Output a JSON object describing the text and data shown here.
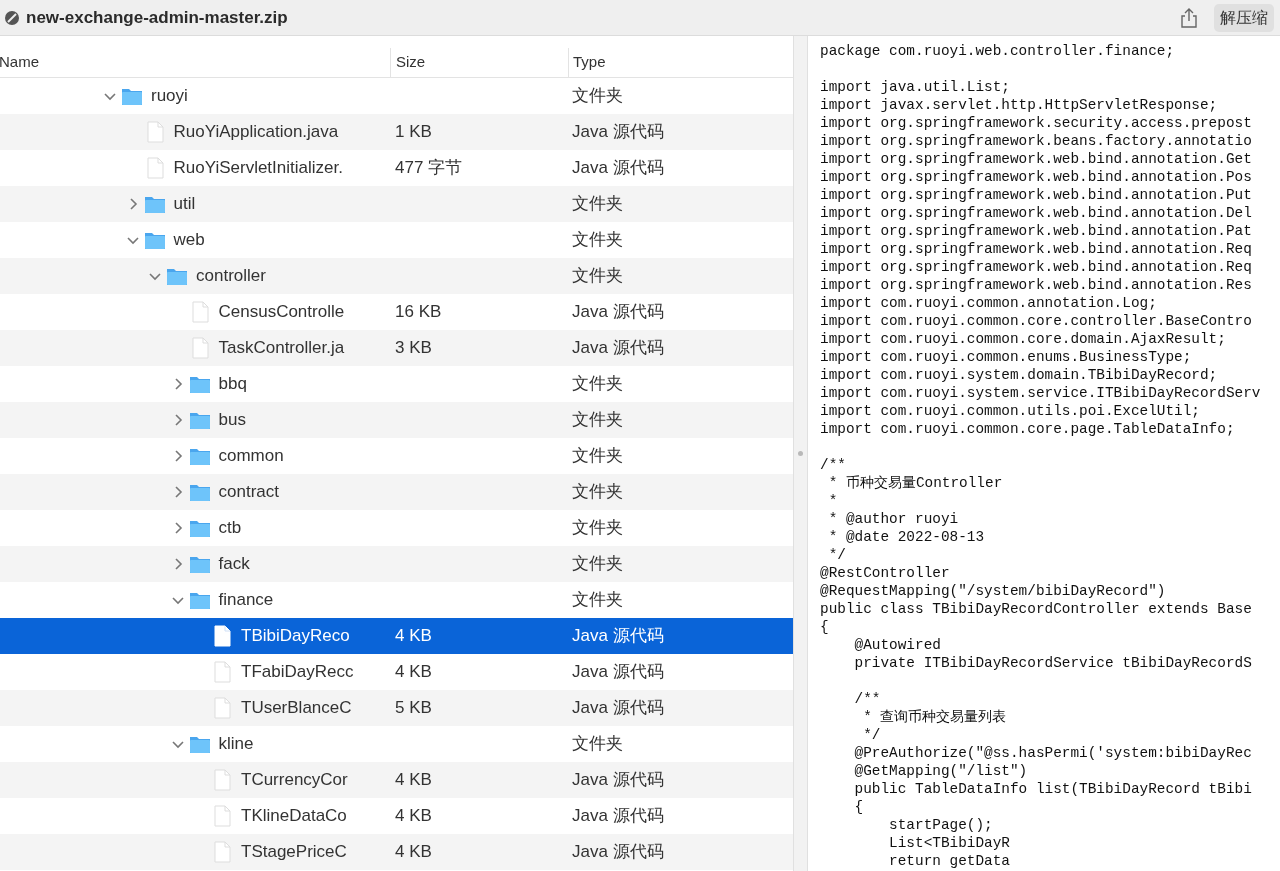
{
  "window": {
    "title": "new-exchange-admin-master.zip",
    "extract_button": "解压缩"
  },
  "columns": [
    "Name",
    "Size",
    "Type"
  ],
  "tree": [
    {
      "name": "ruoyi",
      "kind": "folder",
      "expanded": true,
      "selected": false,
      "type": "文件夹",
      "children": [
        {
          "name": "RuoYiApplication.java",
          "kind": "file",
          "selected": false,
          "size": "1 KB",
          "type": "Java 源代码"
        },
        {
          "name": "RuoYiServletInitializer.",
          "kind": "file",
          "selected": false,
          "size": "477 字节",
          "type": "Java 源代码"
        },
        {
          "name": "util",
          "kind": "folder",
          "expanded": false,
          "selected": false,
          "type": "文件夹"
        },
        {
          "name": "web",
          "kind": "folder",
          "expanded": true,
          "selected": false,
          "type": "文件夹",
          "children": [
            {
              "name": "controller",
              "kind": "folder",
              "expanded": true,
              "selected": false,
              "type": "文件夹",
              "children": [
                {
                  "name": "CensusControlle",
                  "kind": "file",
                  "selected": false,
                  "size": "16 KB",
                  "type": "Java 源代码"
                },
                {
                  "name": "TaskController.ja",
                  "kind": "file",
                  "selected": false,
                  "size": "3 KB",
                  "type": "Java 源代码"
                },
                {
                  "name": "bbq",
                  "kind": "folder",
                  "expanded": false,
                  "selected": false,
                  "type": "文件夹"
                },
                {
                  "name": "bus",
                  "kind": "folder",
                  "expanded": false,
                  "selected": false,
                  "type": "文件夹"
                },
                {
                  "name": "common",
                  "kind": "folder",
                  "expanded": false,
                  "selected": false,
                  "type": "文件夹"
                },
                {
                  "name": "contract",
                  "kind": "folder",
                  "expanded": false,
                  "selected": false,
                  "type": "文件夹"
                },
                {
                  "name": "ctb",
                  "kind": "folder",
                  "expanded": false,
                  "selected": false,
                  "type": "文件夹"
                },
                {
                  "name": "fack",
                  "kind": "folder",
                  "expanded": false,
                  "selected": false,
                  "type": "文件夹"
                },
                {
                  "name": "finance",
                  "kind": "folder",
                  "expanded": true,
                  "selected": false,
                  "type": "文件夹",
                  "children": [
                    {
                      "name": "TBibiDayReco",
                      "kind": "file",
                      "selected": true,
                      "size": "4 KB",
                      "type": "Java 源代码"
                    },
                    {
                      "name": "TFabiDayRecc",
                      "kind": "file",
                      "selected": false,
                      "size": "4 KB",
                      "type": "Java 源代码"
                    },
                    {
                      "name": "TUserBlanceC",
                      "kind": "file",
                      "selected": false,
                      "size": "5 KB",
                      "type": "Java 源代码"
                    }
                  ]
                },
                {
                  "name": "kline",
                  "kind": "folder",
                  "expanded": true,
                  "selected": false,
                  "type": "文件夹",
                  "children": [
                    {
                      "name": "TCurrencyCor",
                      "kind": "file",
                      "selected": false,
                      "size": "4 KB",
                      "type": "Java 源代码"
                    },
                    {
                      "name": "TKlineDataCo",
                      "kind": "file",
                      "selected": false,
                      "size": "4 KB",
                      "type": "Java 源代码"
                    },
                    {
                      "name": "TStagePriceC",
                      "kind": "file",
                      "selected": false,
                      "size": "4 KB",
                      "type": "Java 源代码"
                    }
                  ]
                }
              ]
            }
          ]
        }
      ]
    }
  ],
  "preview": {
    "code_blocks": [
      [
        "package com.ruoyi.web.controller.finance;"
      ],
      [
        "import java.util.List;",
        "import javax.servlet.http.HttpServletResponse;",
        "import org.springframework.security.access.prepost",
        "import org.springframework.beans.factory.annotatio",
        "import org.springframework.web.bind.annotation.Get",
        "import org.springframework.web.bind.annotation.Pos",
        "import org.springframework.web.bind.annotation.Put",
        "import org.springframework.web.bind.annotation.Del",
        "import org.springframework.web.bind.annotation.Pat",
        "import org.springframework.web.bind.annotation.Req",
        "import org.springframework.web.bind.annotation.Req",
        "import org.springframework.web.bind.annotation.Res",
        "import com.ruoyi.common.annotation.Log;",
        "import com.ruoyi.common.core.controller.BaseContro",
        "import com.ruoyi.common.core.domain.AjaxResult;",
        "import com.ruoyi.common.enums.BusinessType;",
        "import com.ruoyi.system.domain.TBibiDayRecord;",
        "import com.ruoyi.system.service.ITBibiDayRecordServ",
        "import com.ruoyi.common.utils.poi.ExcelUtil;",
        "import com.ruoyi.common.core.page.TableDataInfo;"
      ],
      [
        "/**",
        " * 币种交易量Controller",
        " *",
        " * @author ruoyi",
        " * @date 2022-08-13",
        " */",
        "@RestController",
        "@RequestMapping(\"/system/bibiDayRecord\")",
        "public class TBibiDayRecordController extends Base",
        "{",
        "    @Autowired",
        "    private ITBibiDayRecordService tBibiDayRecordS"
      ],
      [
        "    /**",
        "     * 查询币种交易量列表",
        "     */",
        "    @PreAuthorize(\"@ss.hasPermi('system:bibiDayRec",
        "    @GetMapping(\"/list\")",
        "    public TableDataInfo list(TBibiDayRecord tBibi",
        "    {",
        "        startPage();",
        "        List<TBibiDayR",
        "        return getData"
      ]
    ]
  }
}
